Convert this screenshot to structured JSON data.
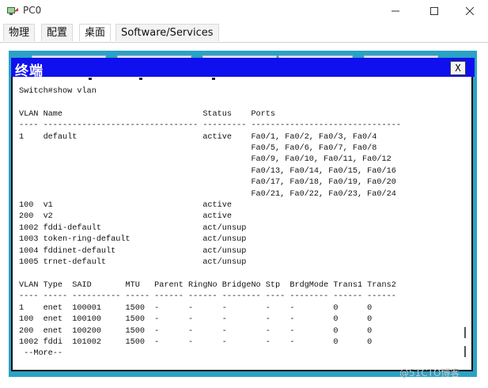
{
  "window": {
    "title": "PC0",
    "minimize_label": "minimize",
    "maximize_label": "maximize",
    "close_label": "close"
  },
  "tabs": [
    {
      "label": "物理"
    },
    {
      "label": "配置"
    },
    {
      "label": "桌面"
    },
    {
      "label": "Software/Services"
    }
  ],
  "terminal": {
    "title": "终端",
    "close_label": "X",
    "lines": [
      "Switch#show vlan",
      "",
      "VLAN Name                             Status    Ports",
      "---- -------------------------------- --------- -------------------------------",
      "1    default                          active    Fa0/1, Fa0/2, Fa0/3, Fa0/4",
      "                                                Fa0/5, Fa0/6, Fa0/7, Fa0/8",
      "                                                Fa0/9, Fa0/10, Fa0/11, Fa0/12",
      "                                                Fa0/13, Fa0/14, Fa0/15, Fa0/16",
      "                                                Fa0/17, Fa0/18, Fa0/19, Fa0/20",
      "                                                Fa0/21, Fa0/22, Fa0/23, Fa0/24",
      "100  v1                               active",
      "200  v2                               active",
      "1002 fddi-default                     act/unsup",
      "1003 token-ring-default               act/unsup",
      "1004 fddinet-default                  act/unsup",
      "1005 trnet-default                    act/unsup",
      "",
      "VLAN Type  SAID       MTU   Parent RingNo BridgeNo Stp  BrdgMode Trans1 Trans2",
      "---- ----- ---------- ----- ------ ------ -------- ---- -------- ------ ------",
      "1    enet  100001     1500  -      -      -        -    -        0      0",
      "100  enet  100100     1500  -      -      -        -    -        0      0",
      "200  enet  100200     1500  -      -      -        -    -        0      0",
      "1002 fddi  101002     1500  -      -      -        -    -        0      0",
      " --More--"
    ]
  },
  "watermark": "@51CTO博客",
  "colors": {
    "frame": "#2aa2c6",
    "title_bar": "#1010ee",
    "terminal_bg": "#ffffff"
  }
}
